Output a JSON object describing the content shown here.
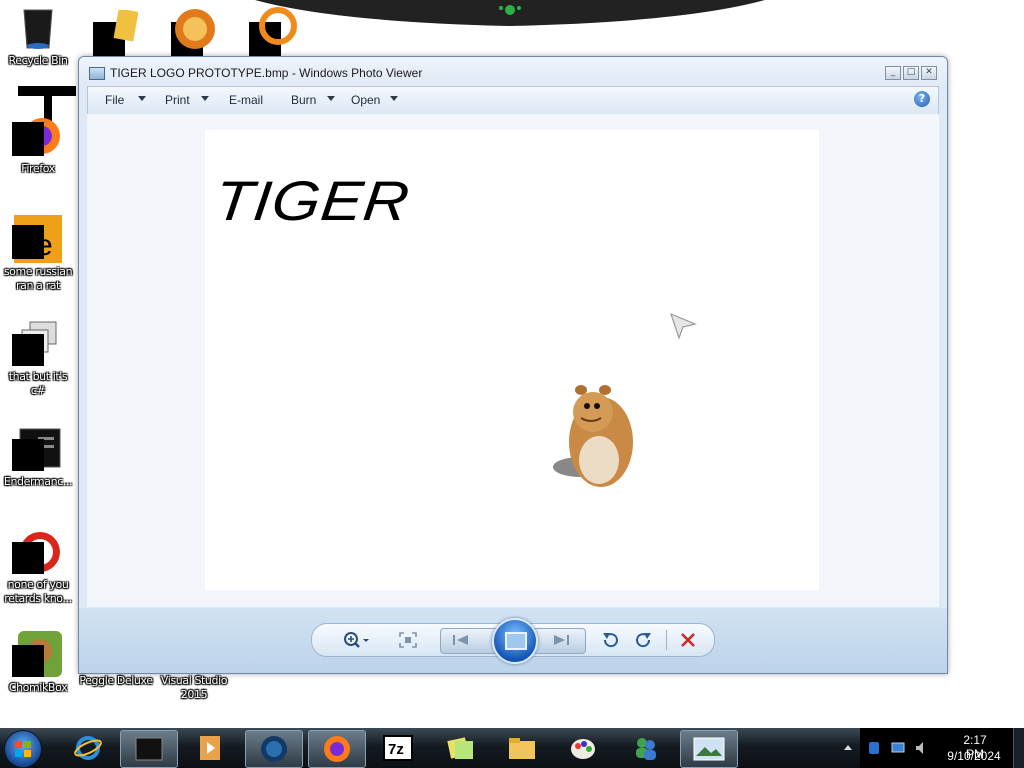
{
  "desktop": {
    "icons": [
      {
        "name": "recycle-bin",
        "label": "Recycle Bin"
      },
      {
        "name": "firefox",
        "label": "Firefox"
      },
      {
        "name": "some-russian-ran-a-rat",
        "label": "some russian ran a rat"
      },
      {
        "name": "that-but-its-csharp",
        "label": "that but it's c#"
      },
      {
        "name": "endermanch",
        "label": "Endermanc..."
      },
      {
        "name": "none-of-you-retards",
        "label": "none of you retards kno..."
      },
      {
        "name": "chomikbox",
        "label": "ChomikBox"
      },
      {
        "name": "peggle-deluxe",
        "label": "Peggle Deluxe"
      },
      {
        "name": "visual-studio-2015",
        "label": "Visual Studio 2015"
      }
    ]
  },
  "window": {
    "title": "TIGER LOGO PROTOTYPE.bmp - Windows Photo Viewer",
    "menu": [
      {
        "label": "File",
        "dropdown": true
      },
      {
        "label": "Print",
        "dropdown": true
      },
      {
        "label": "E-mail",
        "dropdown": false
      },
      {
        "label": "Burn",
        "dropdown": true
      },
      {
        "label": "Open",
        "dropdown": true
      }
    ],
    "image": {
      "text": "TIGER"
    },
    "controls": [
      "zoom",
      "actual-size",
      "previous",
      "slide-show",
      "next",
      "rotate-counterclockwise",
      "rotate-clockwise",
      "delete"
    ]
  },
  "taskbar": {
    "items": [
      "internet-explorer",
      "terminal",
      "media-player",
      "earth",
      "firefox",
      "7zip",
      "sticky-notes",
      "explorer",
      "paint",
      "messenger",
      "photo-viewer"
    ],
    "active": "photo-viewer",
    "clock": {
      "time": "2:17 PM",
      "date": "9/10/2024"
    }
  },
  "colors": {
    "accent": "#1f5fb2",
    "delete": "#cc2b2b",
    "window_frame": "#dfe9f5"
  }
}
